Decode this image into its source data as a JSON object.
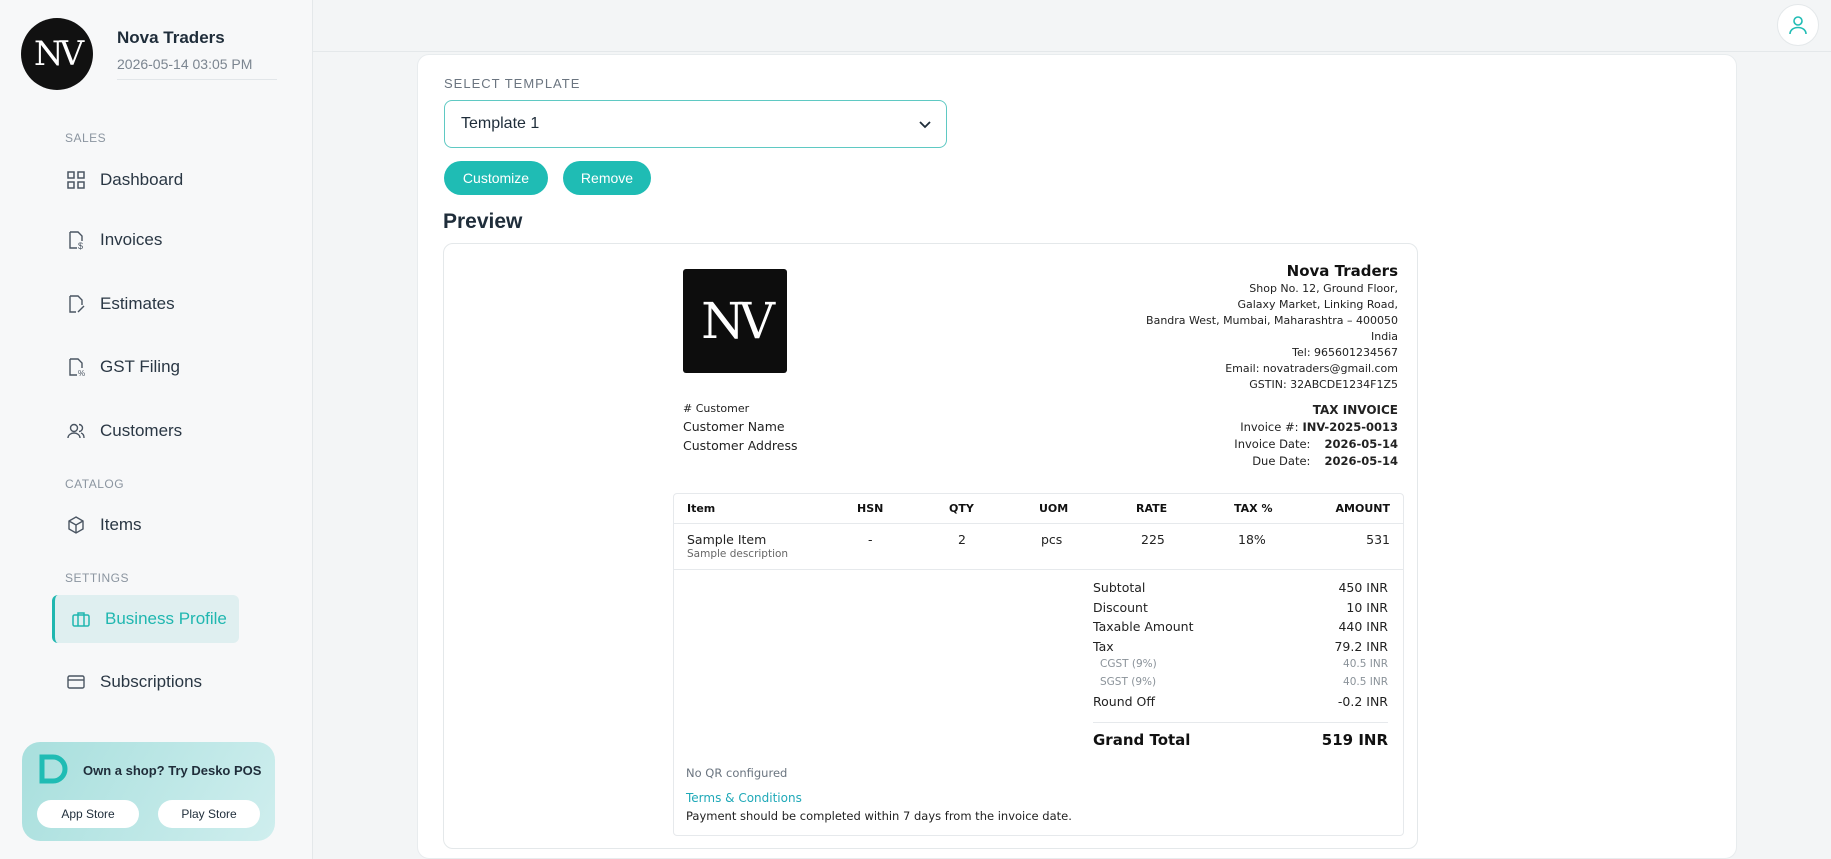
{
  "business": {
    "logo_text": "NV",
    "name": "Nova Traders",
    "datetime": "2026-05-14 03:05 PM"
  },
  "sidebar": {
    "sections": {
      "sales": "SALES",
      "catalog": "CATALOG",
      "settings": "SETTINGS"
    },
    "items": [
      {
        "label": "Dashboard",
        "icon": "grid-icon"
      },
      {
        "label": "Invoices",
        "icon": "invoice-dollar-icon"
      },
      {
        "label": "Estimates",
        "icon": "estimate-pen-icon"
      },
      {
        "label": "GST Filing",
        "icon": "gst-percent-icon"
      },
      {
        "label": "Customers",
        "icon": "users-icon"
      },
      {
        "label": "Items",
        "icon": "box-icon"
      },
      {
        "label": "Business Profile",
        "icon": "briefcase-icon",
        "active": true
      },
      {
        "label": "Subscriptions",
        "icon": "credit-card-icon"
      }
    ],
    "promo": {
      "text": "Own a shop? Try Desko POS",
      "app_store": "App Store",
      "play_store": "Play Store"
    }
  },
  "template": {
    "label": "SELECT TEMPLATE",
    "selected": "Template 1",
    "customize": "Customize",
    "remove": "Remove",
    "preview_title": "Preview"
  },
  "invoice": {
    "company": {
      "name": "Nova Traders",
      "address_lines": [
        "Shop No. 12, Ground Floor,",
        "Galaxy Market, Linking Road,",
        "Bandra West, Mumbai, Maharashtra – 400050",
        "India"
      ],
      "tel": "Tel: 965601234567",
      "email": "Email: novatraders@gmail.com",
      "gstin": "GSTIN: 32ABCDE1234F1Z5"
    },
    "customer": {
      "hash_label": "# Customer",
      "name": "Customer Name",
      "address": "Customer Address"
    },
    "title": "TAX INVOICE",
    "invoice_no_label": "Invoice #:",
    "invoice_no": "INV-2025-0013",
    "invoice_date_label": "Invoice Date:",
    "invoice_date": "2026-05-14",
    "due_date_label": "Due Date:",
    "due_date": "2026-05-14",
    "table": {
      "headers": [
        "Item",
        "HSN",
        "QTY",
        "UOM",
        "RATE",
        "TAX %",
        "AMOUNT"
      ],
      "row": {
        "item": "Sample Item",
        "description": "Sample description",
        "hsn": "-",
        "qty": "2",
        "uom": "pcs",
        "rate": "225",
        "tax": "18%",
        "amount": "531"
      }
    },
    "totals": {
      "subtotal_label": "Subtotal",
      "subtotal": "450 INR",
      "discount_label": "Discount",
      "discount": "10 INR",
      "taxable_label": "Taxable Amount",
      "taxable": "440 INR",
      "tax_label": "Tax",
      "tax": "79.2 INR",
      "cgst_label": "CGST (9%)",
      "cgst": "40.5 INR",
      "sgst_label": "SGST (9%)",
      "sgst": "40.5 INR",
      "roundoff_label": "Round Off",
      "roundoff": "-0.2 INR",
      "grand_label": "Grand Total",
      "grand": "519 INR"
    },
    "qr_note": "No QR configured",
    "terms_label": "Terms & Conditions",
    "terms_text": "Payment should be completed within 7 days from the invoice date."
  },
  "colors": {
    "accent": "#1fbcb4",
    "active_bg": "#dfeff0",
    "link": "#1fa9b8"
  }
}
